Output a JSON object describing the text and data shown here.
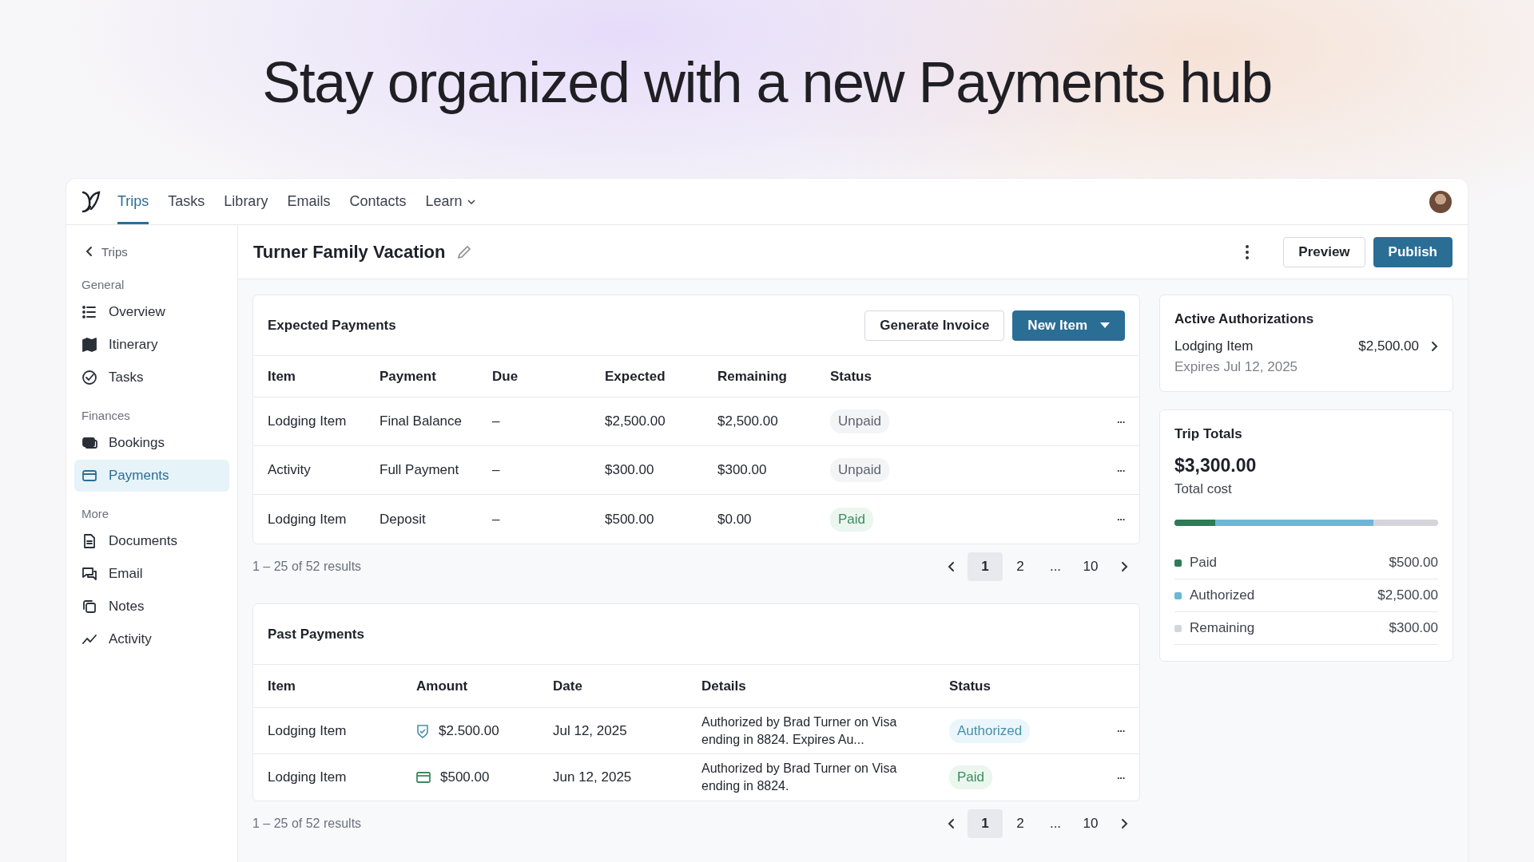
{
  "headline": "Stay organized with a new Payments hub",
  "nav": {
    "tabs": [
      {
        "label": "Trips",
        "selected": true
      },
      {
        "label": "Tasks",
        "selected": false
      },
      {
        "label": "Library",
        "selected": false
      },
      {
        "label": "Emails",
        "selected": false
      },
      {
        "label": "Contacts",
        "selected": false
      },
      {
        "label": "Learn",
        "selected": false,
        "dropdown": true
      }
    ]
  },
  "sidebar": {
    "back": "Trips",
    "sections": [
      {
        "title": "General",
        "items": [
          {
            "label": "Overview",
            "kind": "list",
            "selected": false
          },
          {
            "label": "Itinerary",
            "kind": "map",
            "selected": false
          },
          {
            "label": "Tasks",
            "kind": "check",
            "selected": false
          }
        ]
      },
      {
        "title": "Finances",
        "items": [
          {
            "label": "Bookings",
            "kind": "bookings",
            "selected": false
          },
          {
            "label": "Payments",
            "kind": "card",
            "selected": true
          }
        ]
      },
      {
        "title": "More",
        "items": [
          {
            "label": "Documents",
            "kind": "doc",
            "selected": false
          },
          {
            "label": "Email",
            "kind": "chat",
            "selected": false
          },
          {
            "label": "Notes",
            "kind": "notes",
            "selected": false
          },
          {
            "label": "Activity",
            "kind": "activity",
            "selected": false
          }
        ]
      }
    ]
  },
  "header": {
    "title": "Turner Family Vacation",
    "buttons": [
      "Preview",
      "Publish"
    ]
  },
  "expected_payments": {
    "title": "Expected Payments",
    "buttons": [
      "Generate Invoice",
      "New Item"
    ],
    "columns": [
      "Item",
      "Payment",
      "Due",
      "Expected",
      "Remaining",
      "Status"
    ],
    "rows": [
      {
        "item": "Lodging Item",
        "payment": "Final Balance",
        "due": "–",
        "expected": "$2,500.00",
        "remaining": "$2,500.00",
        "status": {
          "label": "Unpaid",
          "kind": "unpaid"
        },
        "menu": "···"
      },
      {
        "item": "Activity",
        "payment": "Full Payment",
        "due": "–",
        "expected": "$300.00",
        "remaining": "$300.00",
        "status": {
          "label": "Unpaid",
          "kind": "unpaid"
        },
        "menu": "···"
      },
      {
        "item": "Lodging Item",
        "payment": "Deposit",
        "due": "–",
        "expected": "$500.00",
        "remaining": "$0.00",
        "status": {
          "label": "Paid",
          "kind": "paid"
        },
        "menu": "···"
      }
    ],
    "results": "1 – 25 of 52 results",
    "pages": [
      {
        "label": "1",
        "selected": true
      },
      {
        "label": "2",
        "selected": false
      },
      {
        "label": "...",
        "selected": false
      },
      {
        "label": "10",
        "selected": false
      }
    ]
  },
  "past_payments": {
    "title": "Past Payments",
    "columns": [
      "Item",
      "Amount",
      "Date",
      "Details",
      "Status"
    ],
    "rows": [
      {
        "item": "Lodging Item",
        "kind": "authorized",
        "amount": "$2.500.00",
        "date": "Jul 12, 2025",
        "details": "Authorized by Brad Turner on Visa ending in 8824. Expires Au...",
        "status": {
          "label": "Authorized",
          "kind": "authorized"
        },
        "menu": "···"
      },
      {
        "item": "Lodging Item",
        "kind": "card",
        "amount": "$500.00",
        "date": "Jun 12, 2025",
        "details": "Authorized by Brad Turner on Visa ending in 8824.",
        "status": {
          "label": "Paid",
          "kind": "paid"
        },
        "menu": "···"
      }
    ],
    "results": "1 – 25 of 52 results",
    "pages": [
      {
        "label": "1",
        "selected": true
      },
      {
        "label": "2",
        "selected": false
      },
      {
        "label": "...",
        "selected": false
      },
      {
        "label": "10",
        "selected": false
      }
    ]
  },
  "active_authorizations": {
    "title": "Active Authorizations",
    "items": [
      {
        "name": "Lodging Item",
        "amount": "$2,500.00",
        "expires": "Expires Jul 12, 2025"
      }
    ]
  },
  "trip_totals": {
    "title": "Trip Totals",
    "total": "$3,300.00",
    "total_label": "Total cost",
    "breakdown": [
      {
        "label": "Paid",
        "amount": "$500.00",
        "color": "#2f7a57",
        "level": 0.156
      },
      {
        "label": "Authorized",
        "amount": "$2,500.00",
        "color": "#6bb8d4",
        "level": 0.756
      },
      {
        "label": "Remaining",
        "amount": "$300.00",
        "color": "#d3d5da"
      }
    ]
  }
}
